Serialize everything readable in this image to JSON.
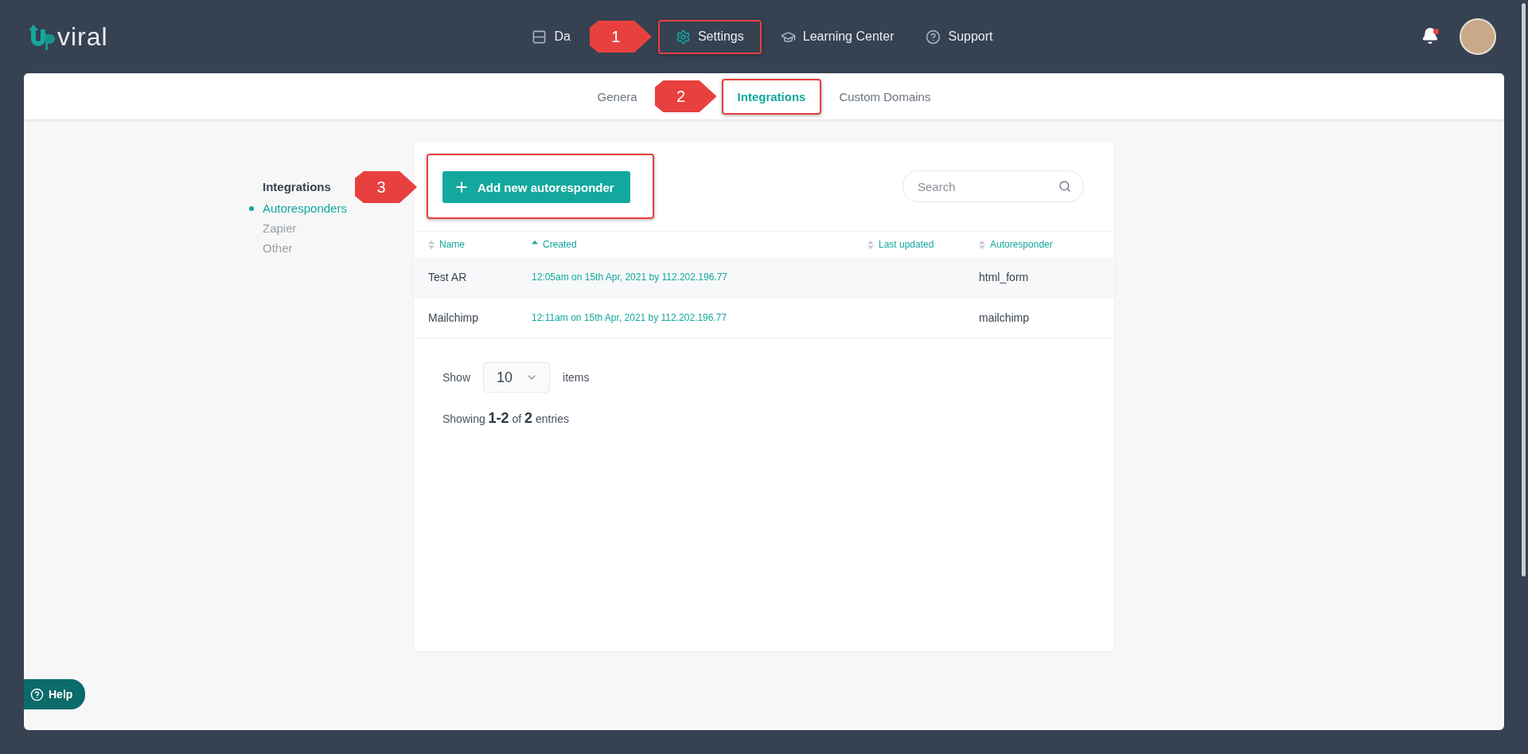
{
  "logo": {
    "text": "viral"
  },
  "nav": [
    {
      "label": "Da",
      "selected": false
    },
    {
      "label": "Settings",
      "selected": true,
      "callout": "1"
    },
    {
      "label": "Learning Center",
      "selected": false
    },
    {
      "label": "Support",
      "selected": false
    }
  ],
  "notifications": {
    "unread": true
  },
  "tabs": [
    {
      "label": "Genera",
      "selected": false
    },
    {
      "label": "Integrations",
      "selected": true,
      "callout": "2"
    },
    {
      "label": "Custom Domains",
      "selected": false
    }
  ],
  "sidebar": {
    "title": "Integrations",
    "items": [
      {
        "label": "Autoresponders",
        "selected": true
      },
      {
        "label": "Zapier",
        "selected": false
      },
      {
        "label": "Other",
        "selected": false
      }
    ]
  },
  "add_button": {
    "label": "Add new autoresponder",
    "callout": "3"
  },
  "search": {
    "placeholder": "Search"
  },
  "table": {
    "columns": [
      {
        "label": "Name",
        "sorted": false
      },
      {
        "label": "Created",
        "sorted": true
      },
      {
        "label": "Last updated",
        "sorted": false
      },
      {
        "label": "Autoresponder",
        "sorted": false
      }
    ],
    "rows": [
      {
        "name": "Test AR",
        "created": "12:05am on 15th Apr, 2021 by 112.202.196.77",
        "autoresponder": "html_form"
      },
      {
        "name": "Mailchimp",
        "created": "12:11am on 15th Apr, 2021 by 112.202.196.77",
        "autoresponder": "mailchimp"
      }
    ]
  },
  "pagination": {
    "show_label": "Show",
    "page_size": "10",
    "items_label": "items",
    "summary": "Showing **1-2** of **2** entries"
  },
  "help": {
    "label": "Help"
  }
}
